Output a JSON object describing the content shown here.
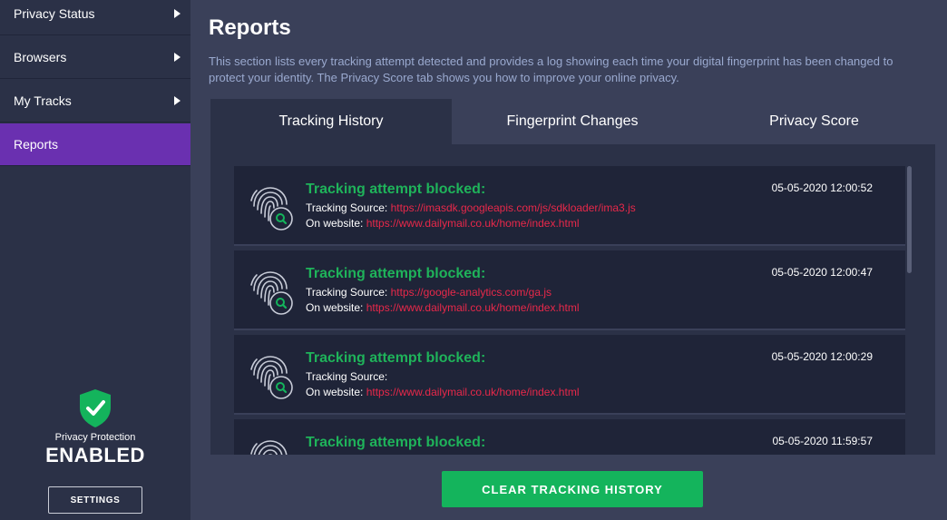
{
  "sidebar": {
    "items": [
      {
        "label": "Privacy Status",
        "has_arrow": true
      },
      {
        "label": "Browsers",
        "has_arrow": true
      },
      {
        "label": "My Tracks",
        "has_arrow": true
      },
      {
        "label": "Reports",
        "active": true
      }
    ],
    "protection_label": "Privacy Protection",
    "protection_status": "ENABLED",
    "settings_label": "SETTINGS"
  },
  "page": {
    "title": "Reports",
    "description": "This section lists every tracking attempt detected and provides a log showing each time your digital fingerprint has been changed to protect your identity. The Privacy Score tab shows you how to improve your online privacy."
  },
  "tabs": [
    {
      "label": "Tracking History",
      "active": true
    },
    {
      "label": "Fingerprint Changes"
    },
    {
      "label": "Privacy Score"
    }
  ],
  "logs": [
    {
      "title": "Tracking attempt blocked:",
      "source_label": "Tracking Source:",
      "source_url": "https://imasdk.googleapis.com/js/sdkloader/ima3.js",
      "site_label": "On website:",
      "site_url": "https://www.dailymail.co.uk/home/index.html",
      "time": "05-05-2020 12:00:52"
    },
    {
      "title": "Tracking attempt blocked:",
      "source_label": "Tracking Source:",
      "source_url": "https://google-analytics.com/ga.js",
      "site_label": "On website:",
      "site_url": "https://www.dailymail.co.uk/home/index.html",
      "time": "05-05-2020 12:00:47"
    },
    {
      "title": "Tracking attempt blocked:",
      "source_label": "Tracking Source:",
      "source_url": "",
      "site_label": "On website:",
      "site_url": "https://www.dailymail.co.uk/home/index.html",
      "time": "05-05-2020 12:00:29"
    },
    {
      "title": "Tracking attempt blocked:",
      "time": "05-05-2020 11:59:57"
    }
  ],
  "actions": {
    "clear_label": "CLEAR TRACKING HISTORY"
  },
  "colors": {
    "accent_purple": "#6a30b0",
    "success_green": "#14b45c",
    "url_red": "#e8284a"
  },
  "icons": {
    "nav_arrow": "chevron-right-icon",
    "shield": "shield-check-icon",
    "log": "fingerprint-search-icon"
  }
}
